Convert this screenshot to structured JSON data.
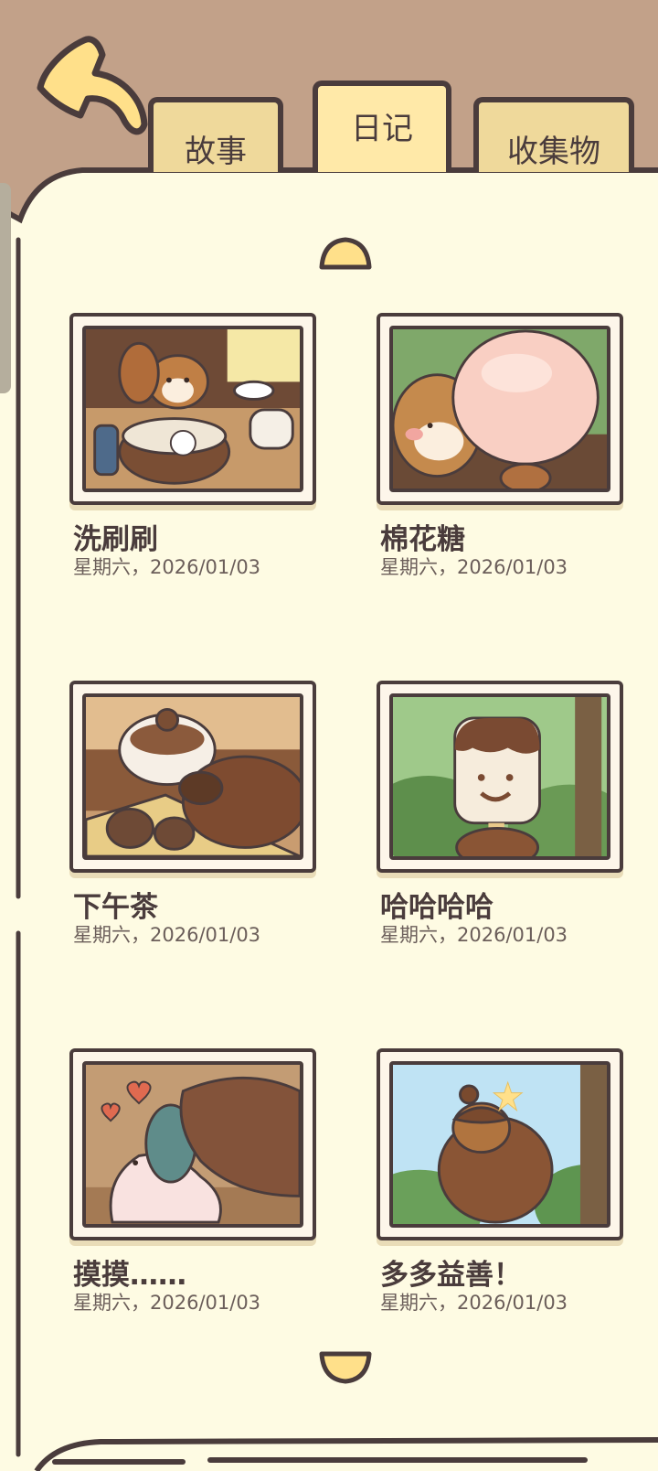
{
  "tabs": [
    {
      "label": "故事",
      "active": false
    },
    {
      "label": "日记",
      "active": true
    },
    {
      "label": "收集物",
      "active": false
    }
  ],
  "entries": [
    {
      "title": "洗刷刷",
      "date": "星期六，2026/01/03",
      "scene": "chipmunk-washing-dishes"
    },
    {
      "title": "棉花糖",
      "date": "星期六，2026/01/03",
      "scene": "chipmunk-with-marshmallow"
    },
    {
      "title": "下午茶",
      "date": "星期六，2026/01/03",
      "scene": "afternoon-tea-cup"
    },
    {
      "title": "哈哈哈哈",
      "date": "星期六，2026/01/03",
      "scene": "ice-cream-bar"
    },
    {
      "title": "摸摸……",
      "date": "星期六，2026/01/03",
      "scene": "petting-slug"
    },
    {
      "title": "多多益善！",
      "date": "星期六，2026/01/03",
      "scene": "acorn-holding"
    }
  ],
  "colors": {
    "background": "#c2a189",
    "paper": "#fefbe3",
    "outline": "#4a3c3c",
    "tab": "#efd99b",
    "tab_active": "#ffe9a8",
    "arrow": "#ffe08a"
  },
  "icons": {
    "back": "back-arrow-icon",
    "scroll_up": "scroll-up-icon",
    "scroll_down": "scroll-down-icon"
  }
}
